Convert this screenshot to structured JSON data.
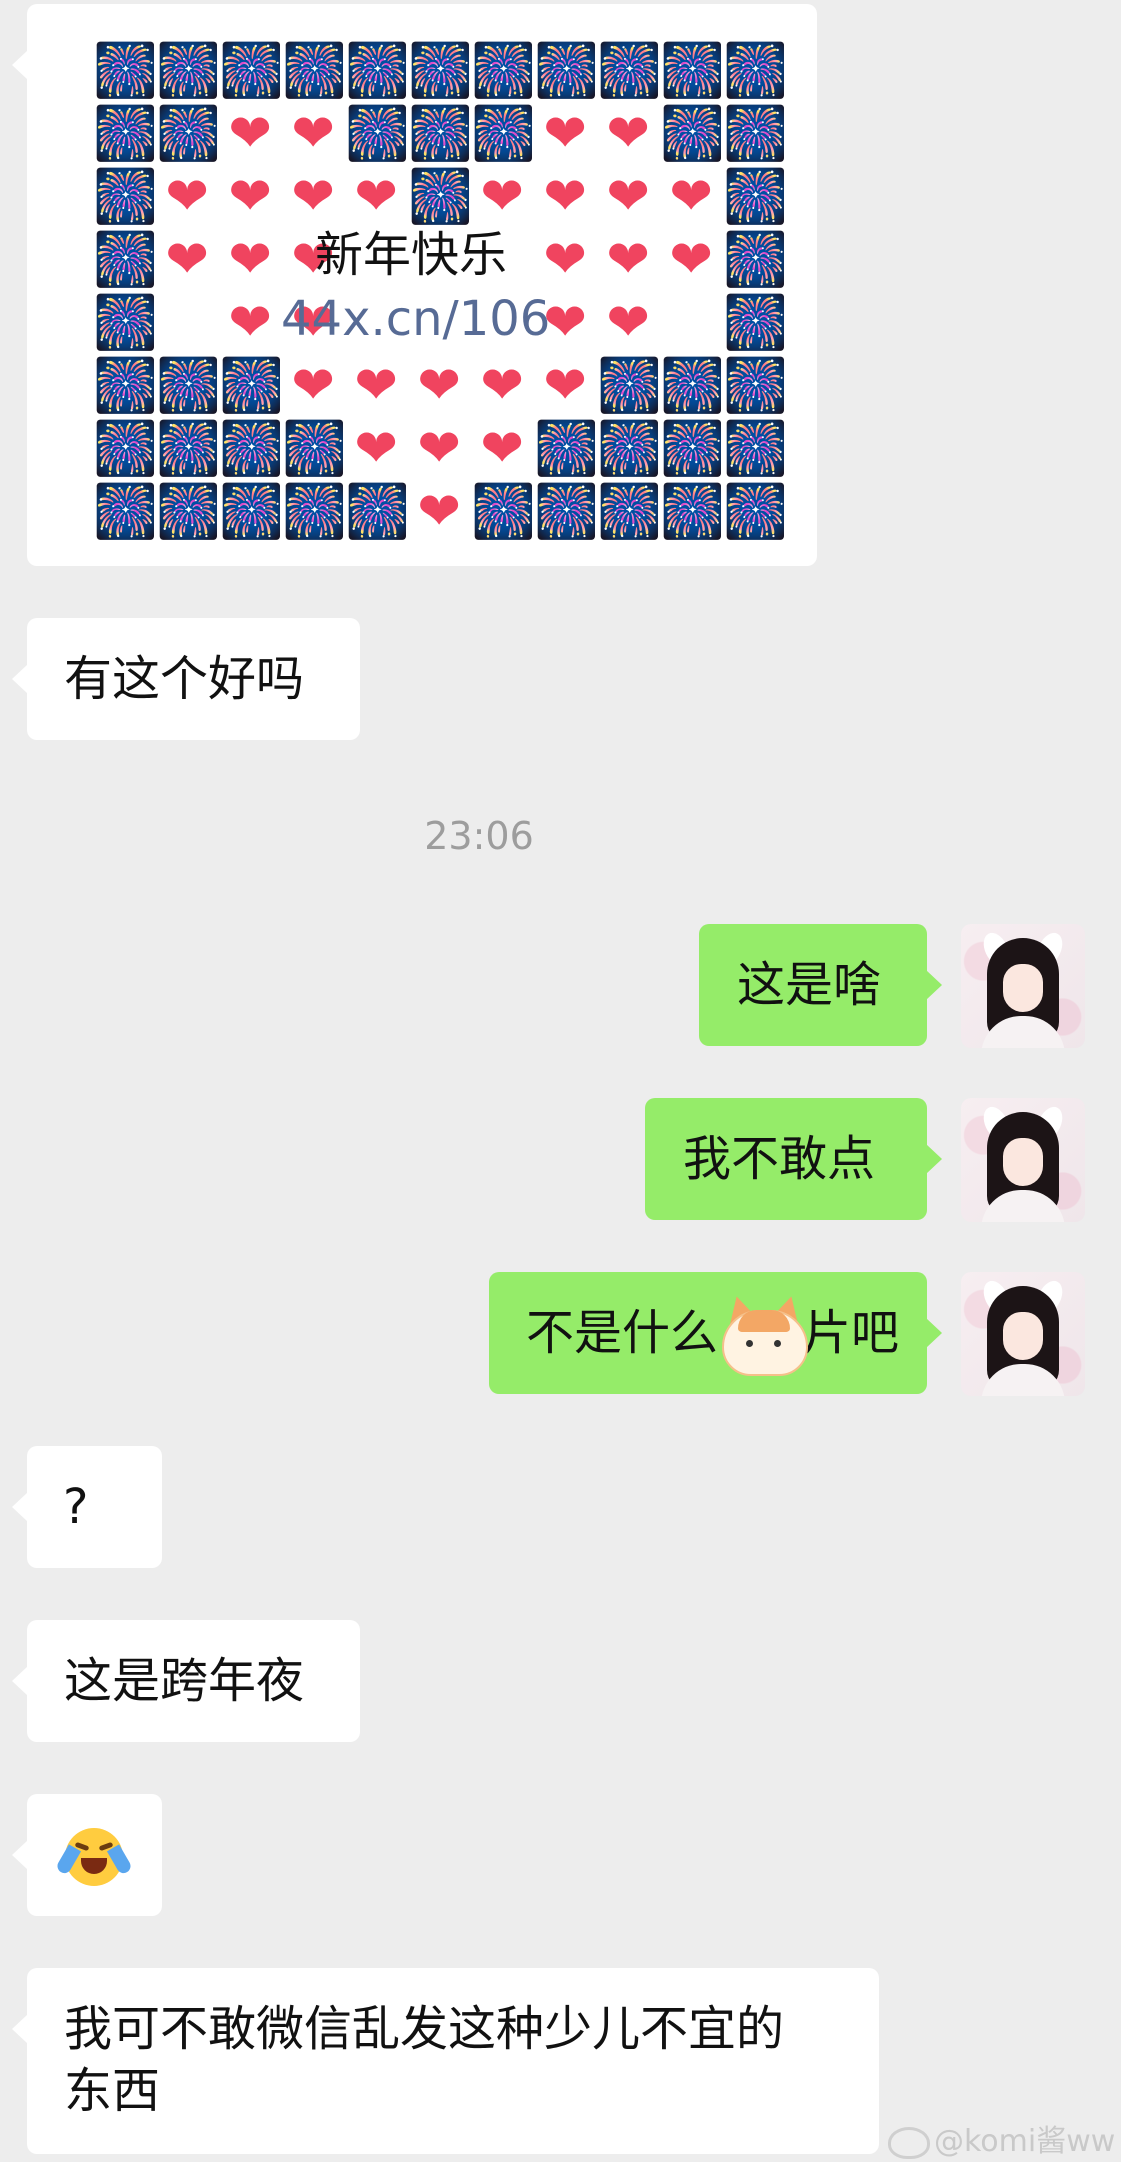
{
  "messages": {
    "m1_greeting": {
      "line1": "新年快乐",
      "link": "44x.cn/106"
    },
    "m2": "有这个好吗",
    "timestamp": "23:06",
    "m3": "这是啥",
    "m4": "我不敢点",
    "m5_left": "不是什么",
    "m5_right": "片吧",
    "m6": "?",
    "m7": "这是跨年夜",
    "m9_line1": "我可不敢微信乱发这种少儿不宜的",
    "m9_line2": "东西"
  },
  "icons": {
    "firework": "🎆",
    "heart": "❤",
    "laugh_cry": "laughing-crying-emoji",
    "sticker": "cat-face-sticker"
  },
  "colors": {
    "background": "#ededed",
    "incoming": "#ffffff",
    "outgoing": "#95ec69",
    "link": "#576b95",
    "time": "#9d9d9d"
  },
  "watermark": "@komi酱ww"
}
